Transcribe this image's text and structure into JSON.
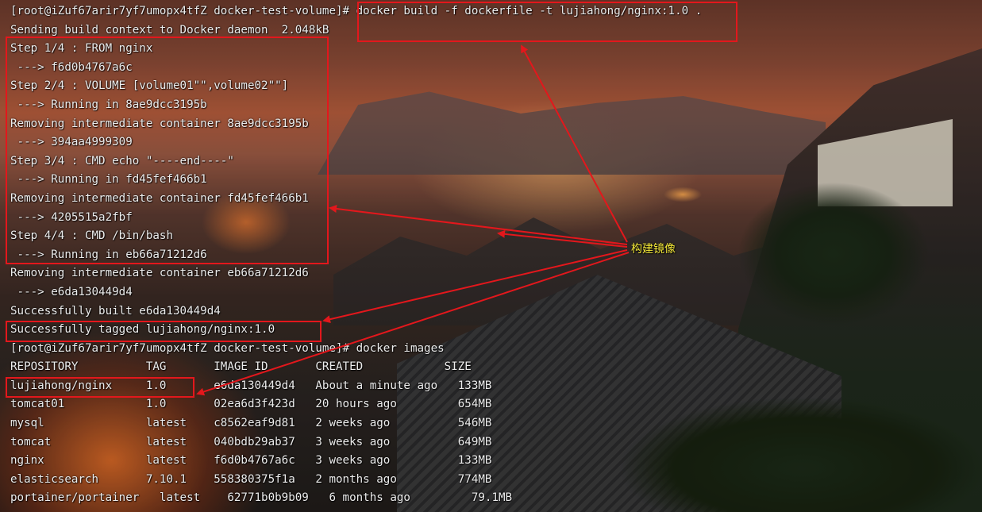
{
  "terminal": {
    "prompt": "[root@iZuf67arir7yf7umopx4tfZ docker-test-volume]#",
    "build_command": " docker build -f dockerfile -t lujiahong/nginx:1.0 .",
    "build_output": [
      "Sending build context to Docker daemon  2.048kB",
      "Step 1/4 : FROM nginx",
      " ---> f6d0b4767a6c",
      "Step 2/4 : VOLUME [volume01\"\",volume02\"\"]",
      " ---> Running in 8ae9dcc3195b",
      "Removing intermediate container 8ae9dcc3195b",
      " ---> 394aa4999309",
      "Step 3/4 : CMD echo \"----end----\"",
      " ---> Running in fd45fef466b1",
      "Removing intermediate container fd45fef466b1",
      " ---> 4205515a2fbf",
      "Step 4/4 : CMD /bin/bash",
      " ---> Running in eb66a71212d6",
      "Removing intermediate container eb66a71212d6",
      " ---> e6da130449d4",
      "Successfully built e6da130449d4",
      "Successfully tagged lujiahong/nginx:1.0"
    ],
    "images_command": " docker images",
    "images_header": "REPOSITORY          TAG       IMAGE ID       CREATED            SIZE",
    "images_rows": [
      "lujiahong/nginx     1.0       e6da130449d4   About a minute ago   133MB",
      "tomcat01            1.0       02ea6d3f423d   20 hours ago         654MB",
      "mysql               latest    c8562eaf9d81   2 weeks ago          546MB",
      "tomcat              latest    040bdb29ab37   3 weeks ago          649MB",
      "nginx               latest    f6d0b4767a6c   3 weeks ago          133MB",
      "elasticsearch       7.10.1    558380375f1a   2 months ago         774MB",
      "portainer/portainer   latest    62771b0b9b09   6 months ago         79.1MB"
    ]
  },
  "annotation": {
    "label": "构建镜像",
    "color": "#e3171c",
    "label_color": "#f6ea3a"
  }
}
